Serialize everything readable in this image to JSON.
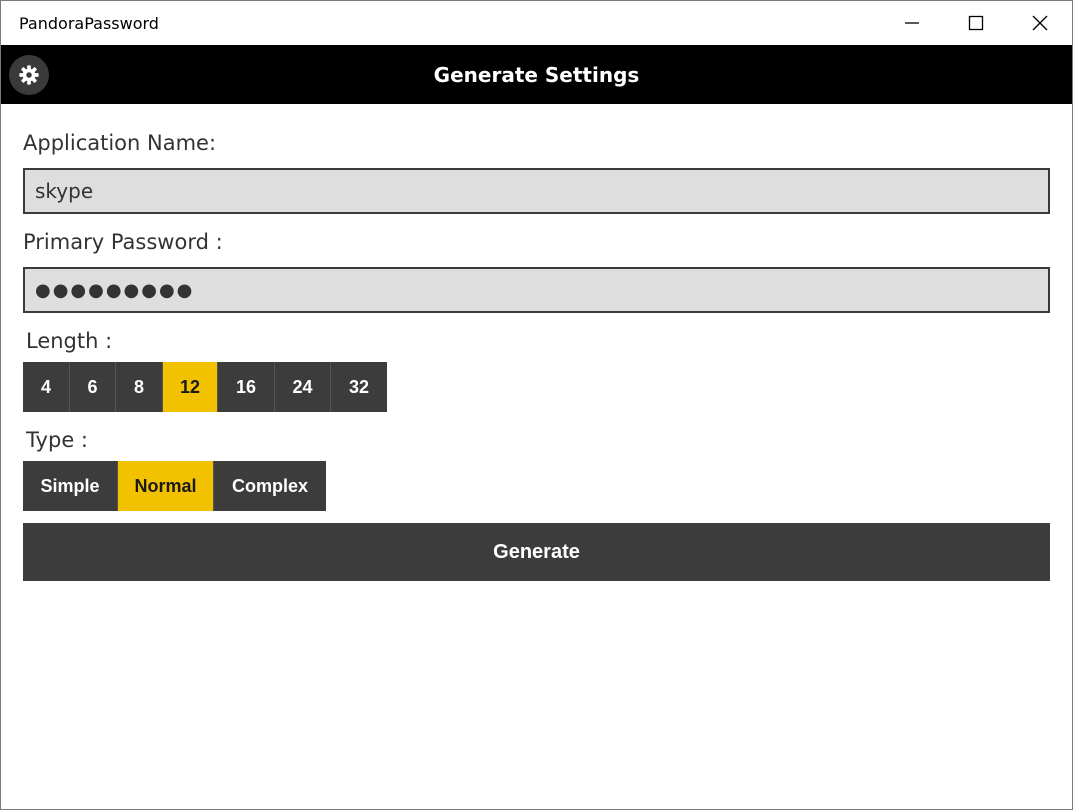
{
  "window": {
    "title": "PandoraPassword"
  },
  "header": {
    "title": "Generate Settings",
    "settings_icon": "gear-icon"
  },
  "form": {
    "app_name_label": "Application Name:",
    "app_name_value": "skype",
    "password_label": "Primary Password :",
    "password_masked": "●●●●●●●●●",
    "length_label": "Length :",
    "length_options": [
      "4",
      "6",
      "8",
      "12",
      "16",
      "24",
      "32"
    ],
    "length_selected": "12",
    "type_label": "Type :",
    "type_options": [
      "Simple",
      "Normal",
      "Complex"
    ],
    "type_selected": "Normal",
    "generate_label": "Generate"
  },
  "colors": {
    "accent": "#f2c100",
    "dark": "#3c3c3c",
    "header_bg": "#000000",
    "input_bg": "#dedede"
  }
}
